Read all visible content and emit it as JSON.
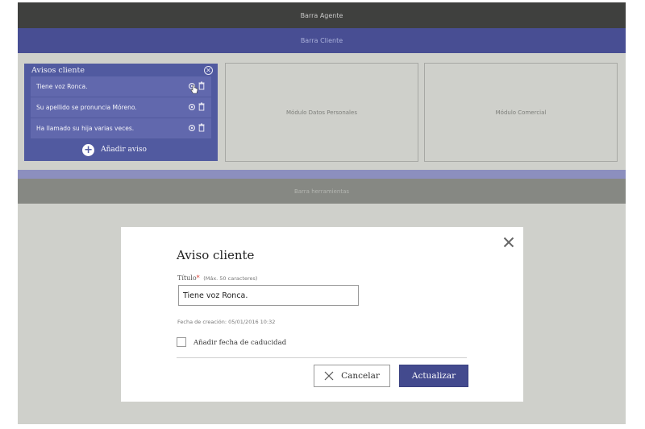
{
  "bars": {
    "agente": "Barra Agente",
    "cliente": "Barra Cliente",
    "herramientas": "Barra herramientas"
  },
  "avisos_panel": {
    "title": "Avisos cliente",
    "items": [
      {
        "text": "Tiene voz Ronca."
      },
      {
        "text": "Su apellido se pronuncia Móreno."
      },
      {
        "text": "Ha llamado su hija varias veces."
      }
    ],
    "add_label": "Añadir aviso"
  },
  "modules": {
    "personal": "Módulo Datos Personales",
    "comercial": "Módulo Comercial"
  },
  "modal": {
    "title": "Aviso cliente",
    "field_label": "Título",
    "required_mark": "*",
    "field_hint": "(Máx. 50 caracteres)",
    "field_value": "Tiene voz Ronca.",
    "fecha": "Fecha de creación: 05/01/2016 10:32",
    "checkbox_label": "Añadir fecha de caducidad",
    "cancel_label": "Cancelar",
    "update_label": "Actualizar"
  },
  "colors": {
    "brand": "#484e93",
    "panel": "#515aa0",
    "agente_bar": "#3f403e",
    "background": "#cfd0cb",
    "primary_button": "#434a8e"
  }
}
